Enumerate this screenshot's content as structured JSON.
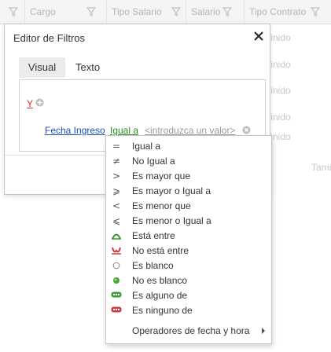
{
  "grid": {
    "columns": [
      "",
      "Cargo",
      "Tipo Salario",
      "Salario",
      "Tipo Contrato"
    ],
    "rows": [
      "finido",
      "finido",
      "finido",
      "finido",
      "finido"
    ],
    "side_text": "Tama"
  },
  "dialog": {
    "title": "Editor de Filtros",
    "tabs": [
      "Visual",
      "Texto"
    ],
    "group_operator": "Y",
    "condition": {
      "field": "Fecha Ingreso",
      "operator": "Igual a",
      "value_placeholder": "<introduzca un valor>"
    }
  },
  "menu": {
    "items": [
      {
        "label": "Igual a",
        "icon": "equals-icon",
        "glyph": "="
      },
      {
        "label": "No Igual a",
        "icon": "not-equal-icon",
        "glyph": "≠"
      },
      {
        "label": "Es mayor que",
        "icon": "greater-than-icon",
        "glyph": ">"
      },
      {
        "label": "Es mayor o Igual a",
        "icon": "greater-or-equal-icon",
        "glyph": "⩾"
      },
      {
        "label": "Es menor que",
        "icon": "less-than-icon",
        "glyph": "<"
      },
      {
        "label": "Es menor o Igual a",
        "icon": "less-or-equal-icon",
        "glyph": "⩽"
      },
      {
        "label": "Está entre",
        "icon": "between-icon",
        "glyph": ""
      },
      {
        "label": "No está entre",
        "icon": "not-between-icon",
        "glyph": ""
      },
      {
        "label": "Es blanco",
        "icon": "blank-icon",
        "glyph": ""
      },
      {
        "label": "No es blanco",
        "icon": "not-blank-icon",
        "glyph": ""
      },
      {
        "label": "Es alguno de",
        "icon": "any-of-icon",
        "glyph": ""
      },
      {
        "label": "Es ninguno de",
        "icon": "none-of-icon",
        "glyph": ""
      }
    ],
    "submenu_label": "Operadores de fecha y hora"
  },
  "colors": {
    "group_operator": "#d63232",
    "field_link": "#1f4db8",
    "operator_link": "#2a8a2a",
    "placeholder": "#9a9a9a"
  }
}
